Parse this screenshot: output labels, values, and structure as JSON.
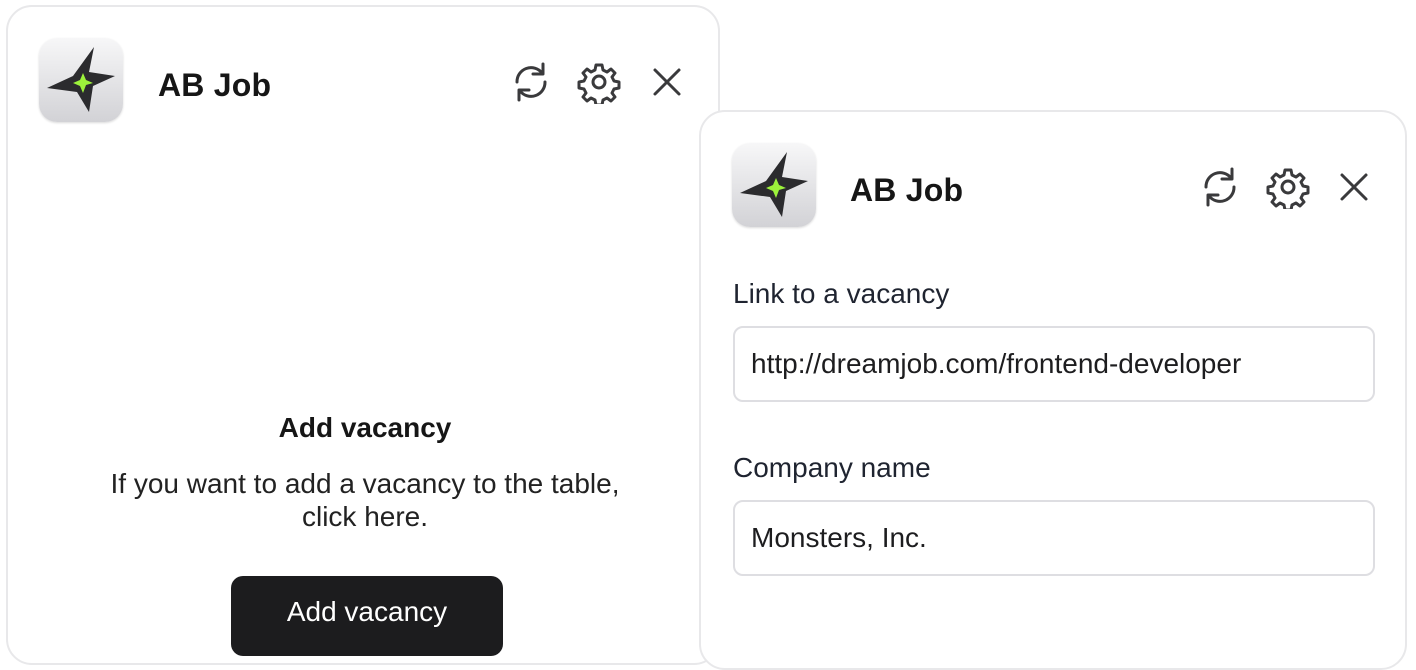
{
  "colors": {
    "logo_star": "#2b2b2e",
    "logo_spark": "#9cf23b",
    "button_bg": "#1c1c1e",
    "border": "#e2e2e6"
  },
  "panel_left": {
    "app_title": "AB Job",
    "icons": [
      "refresh-icon",
      "gear-icon",
      "close-icon"
    ],
    "empty_state": {
      "title": "Add vacancy",
      "description": "If you want to add a vacancy to the table, click here.",
      "button_label": "Add vacancy"
    }
  },
  "panel_right": {
    "app_title": "AB Job",
    "icons": [
      "refresh-icon",
      "gear-icon",
      "close-icon"
    ],
    "form": {
      "link_label": "Link to a vacancy",
      "link_value": "http://dreamjob.com/frontend-developer",
      "company_label": "Company name",
      "company_value": "Monsters, Inc."
    }
  }
}
